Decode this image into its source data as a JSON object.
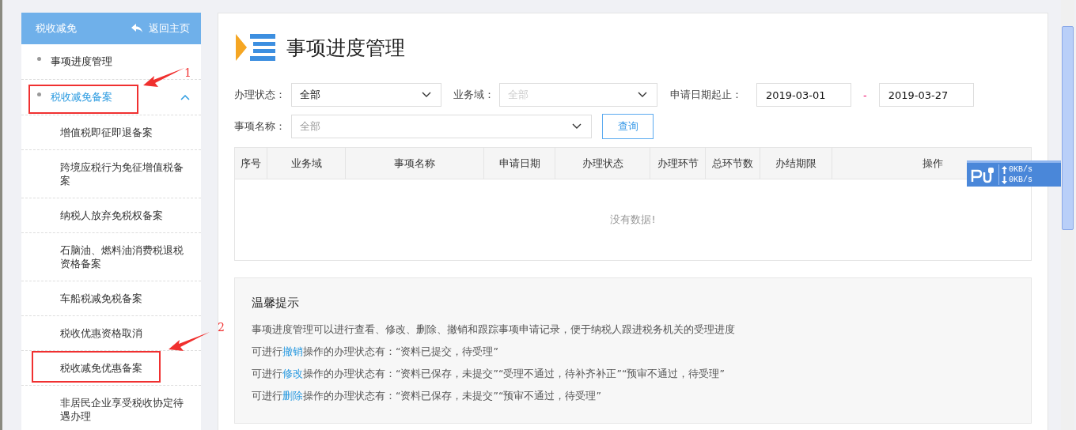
{
  "sidebar": {
    "title": "税收减免",
    "back_link": "返回主页",
    "items": [
      {
        "label": "事项进度管理",
        "selected": false
      },
      {
        "label": "税收减免备案",
        "selected": true,
        "expanded": true,
        "children": [
          {
            "label": "增值税即征即退备案"
          },
          {
            "label": "跨境应税行为免征增值税备案"
          },
          {
            "label": "纳税人放弃免税权备案"
          },
          {
            "label": "石脑油、燃料油消费税退税资格备案"
          },
          {
            "label": "车船税减免税备案"
          },
          {
            "label": "税收优惠资格取消"
          },
          {
            "label": "税收减免优惠备案"
          },
          {
            "label": "非居民企业享受税收协定待遇办理"
          }
        ]
      }
    ]
  },
  "page": {
    "title": "事项进度管理"
  },
  "filters": {
    "status": {
      "label": "办理状态：",
      "value": "全部"
    },
    "domain": {
      "label": "业务域：",
      "placeholder": "全部",
      "disabled": true
    },
    "date_range": {
      "label": "申请日期起止：",
      "from": "2019-03-01",
      "separator": "-",
      "to": "2019-03-27"
    },
    "item_name": {
      "label": "事项名称：",
      "placeholder": "全部"
    },
    "query_button": "查询"
  },
  "table": {
    "columns": [
      "序号",
      "业务域",
      "事项名称",
      "申请日期",
      "办理状态",
      "办理环节",
      "总环节数",
      "办结期限",
      "操作"
    ],
    "empty_text": "没有数据!"
  },
  "tips": {
    "title": "温馨提示",
    "lines": [
      {
        "before": "事项进度管理可以进行查看、修改、删除、撤销和跟踪事项申请记录，便于纳税人跟进税务机关的受理进度"
      },
      {
        "before": "可进行",
        "link": "撤销",
        "after": "操作的办理状态有：“资料已提交，待受理”"
      },
      {
        "before": "可进行",
        "link": "修改",
        "after": "操作的办理状态有：“资料已保存，未提交”“受理不通过，待补齐补正”“预审不通过，待受理”"
      },
      {
        "before": "可进行",
        "link": "删除",
        "after": "操作的办理状态有：“资料已保存，未提交”“预审不通过，待受理”"
      }
    ]
  },
  "annotations": [
    {
      "number": "1"
    },
    {
      "number": "2"
    }
  ],
  "net_monitor": {
    "upload": "0KB/s",
    "download": "0KB/s"
  }
}
